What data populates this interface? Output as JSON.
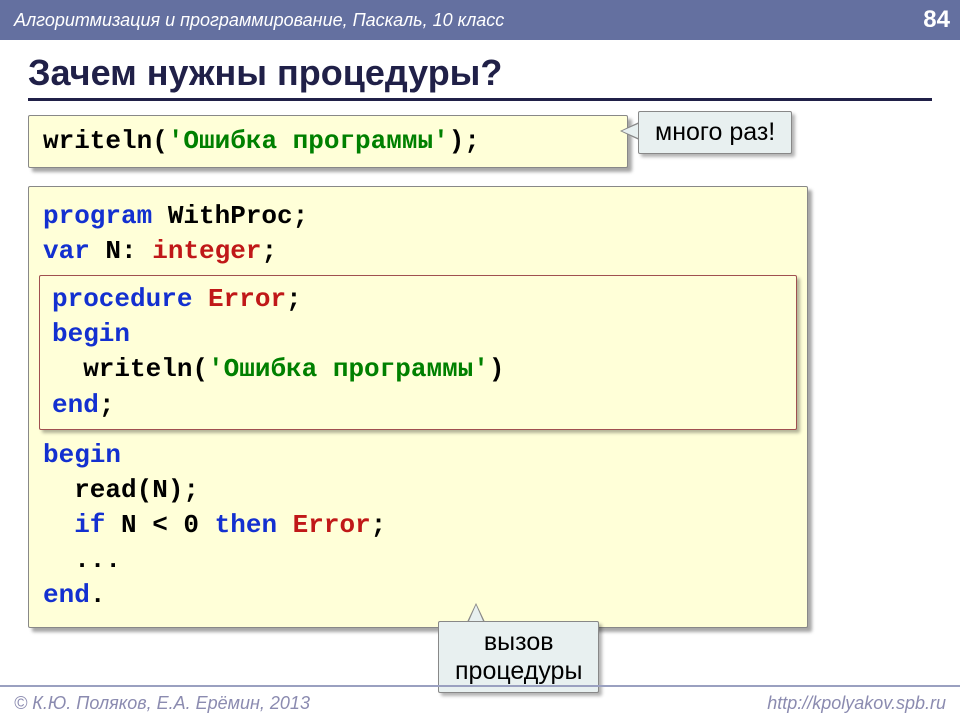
{
  "header": {
    "subject": "Алгоритмизация и программирование, Паскаль, 10 класс",
    "page": "84"
  },
  "title": "Зачем нужны процедуры?",
  "code1": {
    "writeln": "writeln",
    "open": "(",
    "str": "'Ошибка программы'",
    "close": ");"
  },
  "callout1": "много раз!",
  "code2": {
    "l1a": "program",
    "l1b": " WithProc;",
    "l2a": "var",
    "l2b": " N: ",
    "l2c": "integer",
    "l2d": ";",
    "proc": {
      "l1a": "procedure ",
      "l1b": "Error",
      "l1c": ";",
      "l2": "begin",
      "l3a": "  writeln(",
      "l3b": "'Ошибка программы'",
      "l3c": ")",
      "l4a": "end",
      "l4b": ";"
    },
    "l3": "begin",
    "l4": "  read(N);",
    "l5a": "  if",
    "l5b": " N < 0 ",
    "l5c": "then ",
    "l5d": "Error",
    "l5e": ";",
    "l6": "  ...",
    "l7a": "end",
    "l7b": "."
  },
  "callout2_l1": "вызов",
  "callout2_l2": "процедуры",
  "footer": {
    "copyright": "© К.Ю. Поляков, Е.А. Ерёмин, 2013",
    "url": "http://kpolyakov.spb.ru"
  }
}
